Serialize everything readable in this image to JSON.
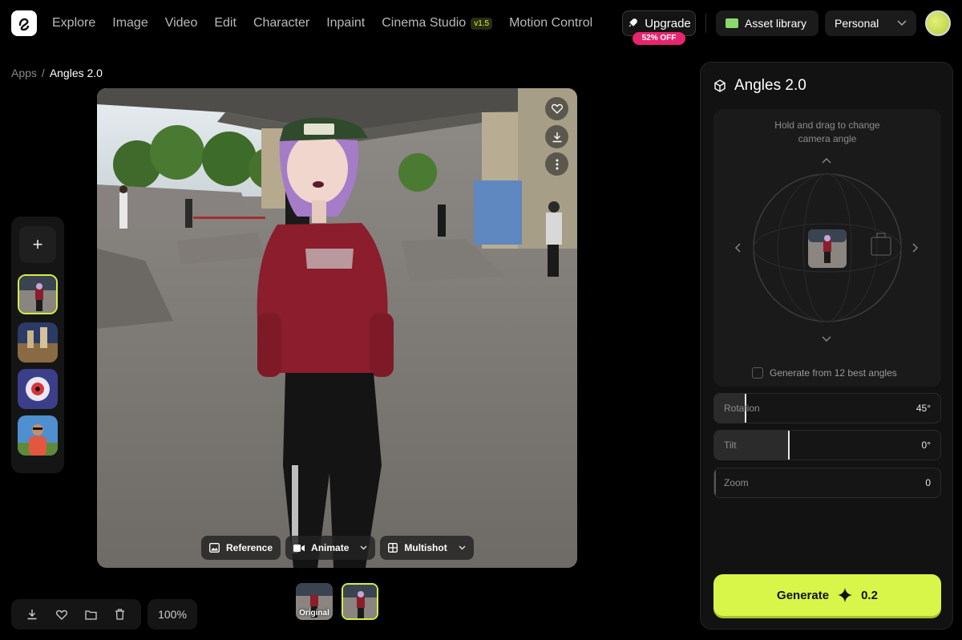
{
  "nav": {
    "items": [
      {
        "label": "Explore"
      },
      {
        "label": "Image"
      },
      {
        "label": "Video"
      },
      {
        "label": "Edit"
      },
      {
        "label": "Character"
      },
      {
        "label": "Inpaint"
      },
      {
        "label": "Cinema Studio",
        "badge": "v1.5"
      },
      {
        "label": "Motion Control"
      }
    ],
    "upgrade_label": "Upgrade",
    "discount_badge": "52% OFF",
    "asset_library_label": "Asset library",
    "workspace_label": "Personal"
  },
  "breadcrumb": {
    "parent": "Apps",
    "separator": "/",
    "current": "Angles 2.0"
  },
  "rail": {
    "add_symbol": "+"
  },
  "image_toolbar": {
    "reference_label": "Reference",
    "animate_label": "Animate",
    "multishot_label": "Multishot"
  },
  "bottom": {
    "zoom": "100%",
    "original_label": "Original"
  },
  "panel": {
    "title": "Angles 2.0",
    "hint": "Hold and drag to change camera angle",
    "best_angles_label": "Generate from 12 best angles",
    "sliders": [
      {
        "label": "Rotation",
        "value": "45°",
        "level": 0.14
      },
      {
        "label": "Tilt",
        "value": "0°",
        "level": 0.33
      },
      {
        "label": "Zoom",
        "value": "0",
        "level": 0.0
      }
    ],
    "generate_label": "Generate",
    "generate_cost": "0.2"
  },
  "colors": {
    "accent": "#d8f54a",
    "badge_pink": "#e6256e",
    "background": "#000000",
    "panel": "#121212"
  }
}
